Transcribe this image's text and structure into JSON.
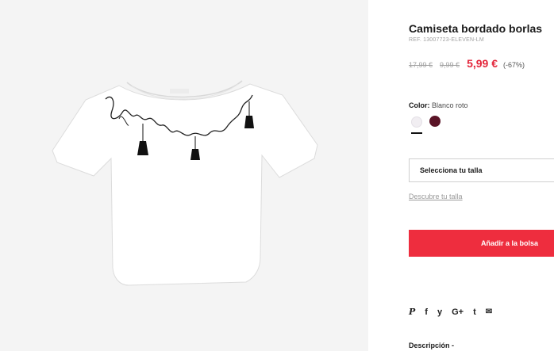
{
  "product": {
    "title": "Camiseta bordado borlas",
    "ref": "REF. 13007723-ELEVEN-LM",
    "price_original": "17,99 €",
    "price_previous": "9,99 €",
    "price_current": "5,99 €",
    "discount": "(-67%)"
  },
  "color": {
    "label": "Color:",
    "value": "Blanco roto",
    "swatches": [
      {
        "name": "Blanco roto",
        "hex": "#f1eef2",
        "selected": true
      },
      {
        "name": "wine",
        "hex": "#5a1426",
        "selected": false
      }
    ]
  },
  "size": {
    "select_label": "Selecciona tu talla",
    "guide_link": "Descubre tu talla"
  },
  "cta": {
    "add_to_bag": "Añadir a la bolsa"
  },
  "share": {
    "icons": [
      "pinterest-icon",
      "facebook-icon",
      "twitter-icon",
      "google-plus-icon",
      "tumblr-icon",
      "email-icon"
    ],
    "glyphs": {
      "pinterest": "P",
      "facebook": "f",
      "twitter": "y",
      "googleplus": "G+",
      "tumblr": "t",
      "email": "✉"
    }
  },
  "description": {
    "heading": "Descripción -"
  },
  "image": {
    "embroidery_text": "tres lovely"
  },
  "colors": {
    "accent": "#ee2d3e",
    "price_red": "#e3263b",
    "image_bg": "#f4f4f4"
  }
}
